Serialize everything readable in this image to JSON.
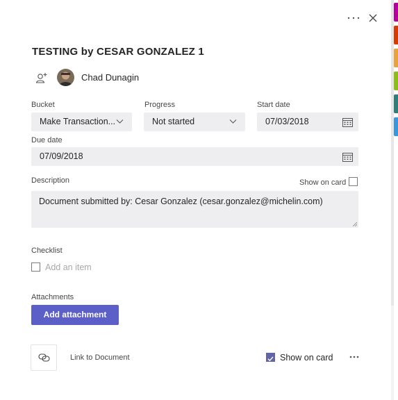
{
  "task": {
    "title": "TESTING by CESAR GONZALEZ 1",
    "assignee": "Chad Dunagin"
  },
  "fields": {
    "bucket": {
      "label": "Bucket",
      "value": "Make Transaction..."
    },
    "progress": {
      "label": "Progress",
      "value": "Not started"
    },
    "start_date": {
      "label": "Start date",
      "value": "07/03/2018"
    },
    "due_date": {
      "label": "Due date",
      "value": "07/09/2018"
    }
  },
  "description": {
    "label": "Description",
    "show_on_card": "Show on card",
    "show_on_card_checked": false,
    "text": "Document submitted by: Cesar Gonzalez (cesar.gonzalez@michelin.com)"
  },
  "checklist": {
    "label": "Checklist",
    "placeholder": "Add an item"
  },
  "attachments": {
    "label": "Attachments",
    "add_button": "Add attachment",
    "items": [
      {
        "name": "Link to Document",
        "show_on_card": "Show on card",
        "show_on_card_checked": true
      }
    ]
  },
  "label_colors": [
    "#b4009e",
    "#d83b01",
    "#e8a33d",
    "#8cbd18",
    "#2f7e7a",
    "#3a96dd"
  ],
  "accent_color": "#5b5fc7"
}
